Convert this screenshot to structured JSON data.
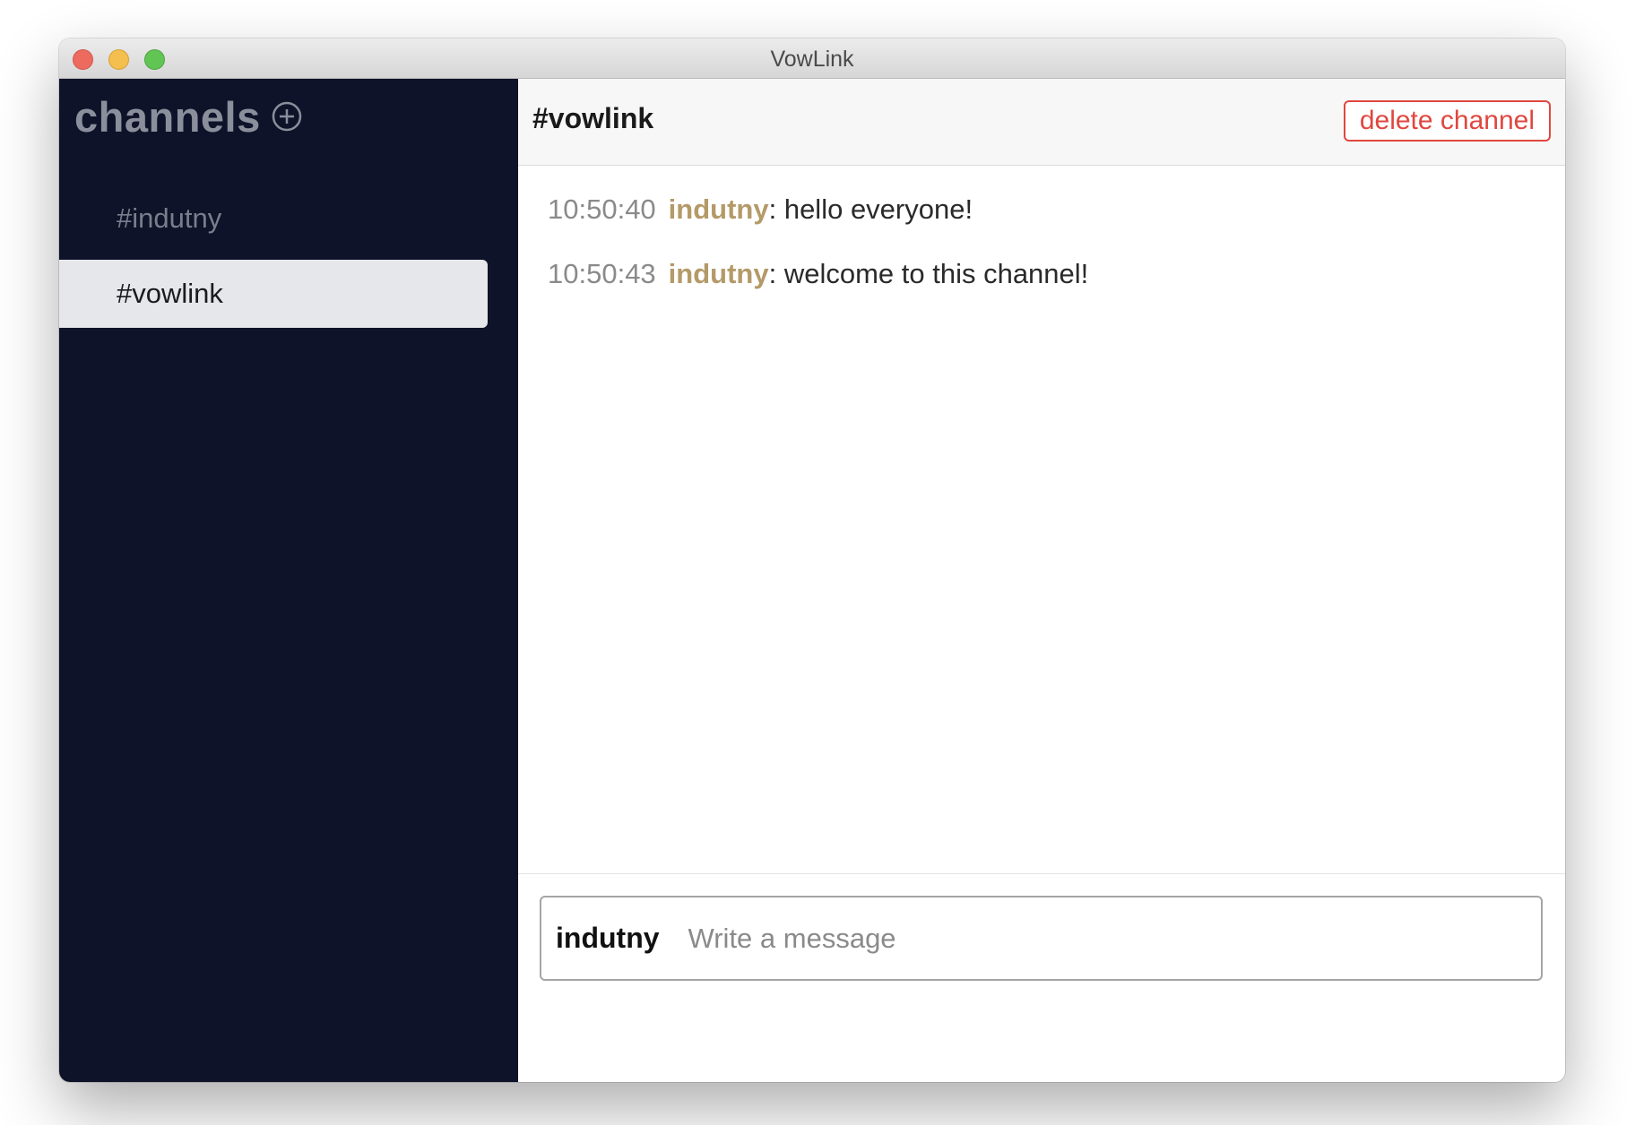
{
  "window": {
    "title": "VowLink"
  },
  "sidebar": {
    "title": "channels",
    "add_icon": "plus-circle-icon",
    "channels": [
      {
        "label": "#indutny",
        "active": false
      },
      {
        "label": "#vowlink",
        "active": true
      }
    ]
  },
  "header": {
    "channel_name": "#vowlink",
    "delete_label": "delete channel"
  },
  "messages": [
    {
      "time": "10:50:40",
      "user": "indutny",
      "separator": ": ",
      "text": "hello everyone!"
    },
    {
      "time": "10:50:43",
      "user": "indutny",
      "separator": ": ",
      "text": "welcome to this channel!"
    }
  ],
  "composer": {
    "user": "indutny",
    "placeholder": "Write a message",
    "value": ""
  },
  "colors": {
    "sidebar_bg": "#0e1329",
    "active_channel_bg": "#e6e7ea",
    "username": "#b39a68",
    "delete_accent": "#e0473f"
  }
}
